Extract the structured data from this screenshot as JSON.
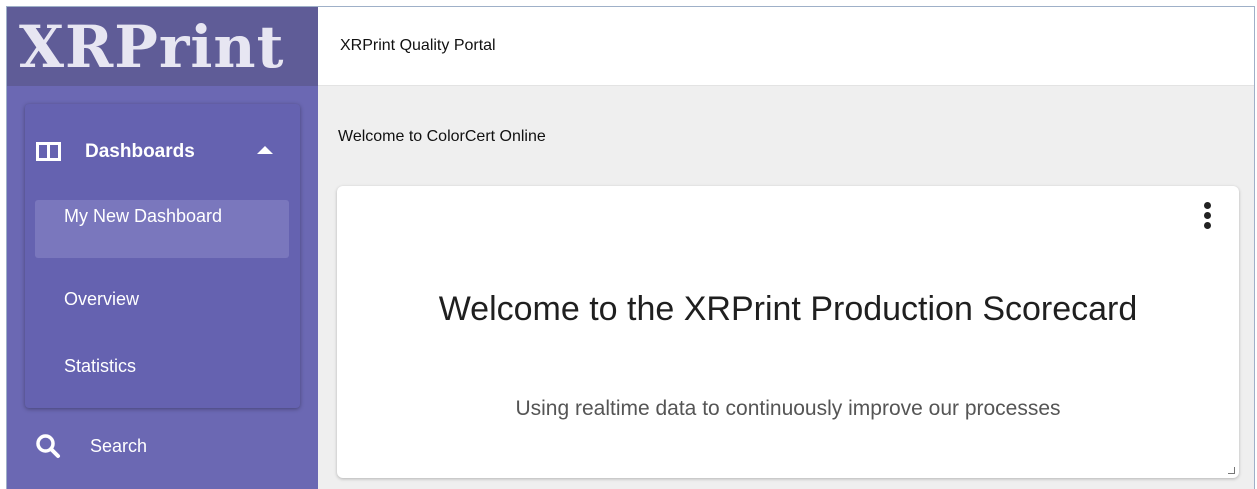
{
  "app": {
    "logo_text": "XRPrint",
    "portal_title": "XRPrint Quality Portal",
    "welcome_text": "Welcome to ColorCert Online"
  },
  "sidebar": {
    "section": {
      "label": "Dashboards",
      "icon": "dashboard-columns-icon",
      "expanded": true
    },
    "items": [
      {
        "label": "My New Dashboard",
        "active": true
      },
      {
        "label": "Overview",
        "active": false
      },
      {
        "label": "Statistics",
        "active": false
      }
    ],
    "search": {
      "label": "Search",
      "icon": "search-icon"
    }
  },
  "card": {
    "title": "Welcome to the XRPrint Production Scorecard",
    "subtitle": "Using realtime data to continuously improve our processes",
    "menu_icon": "kebab-menu-icon"
  },
  "colors": {
    "sidebar": "#6b68b3",
    "logo_bar": "#5f5c97",
    "active_item": "#7a77bd",
    "main_bg": "#efefef"
  }
}
